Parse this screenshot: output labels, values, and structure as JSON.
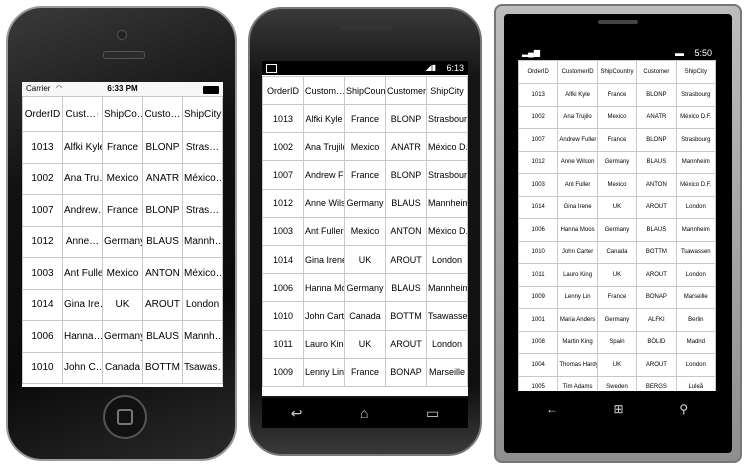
{
  "iphone": {
    "status": {
      "carrier": "Carrier",
      "wifi_icon": "wifi-icon",
      "time": "6:33 PM",
      "battery_icon": "battery-icon"
    },
    "headers": [
      "OrderID",
      "Cust…",
      "ShipCo…",
      "Custo…",
      "ShipCity"
    ],
    "rows": [
      [
        "1013",
        "Alfki Kyle",
        "France",
        "BLONP",
        "Stras…"
      ],
      [
        "1002",
        "Ana Tru…",
        "Mexico",
        "ANATR",
        "México…"
      ],
      [
        "1007",
        "Andrew…",
        "France",
        "BLONP",
        "Stras…"
      ],
      [
        "1012",
        "Anne…",
        "Germany",
        "BLAUS",
        "Mannh…"
      ],
      [
        "1003",
        "Ant Fuller",
        "Mexico",
        "ANTON",
        "México…"
      ],
      [
        "1014",
        "Gina Ire…",
        "UK",
        "AROUT",
        "London"
      ],
      [
        "1006",
        "Hanna…",
        "Germany",
        "BLAUS",
        "Mannh…"
      ],
      [
        "1010",
        "John C…",
        "Canada",
        "BOTTM",
        "Tsawas…"
      ]
    ]
  },
  "android": {
    "status": {
      "time": "6:13"
    },
    "headers": [
      "OrderID",
      "Custom…",
      "ShipCoun…",
      "Customer",
      "ShipCity"
    ],
    "rows": [
      [
        "1013",
        "Alfki Kyle",
        "France",
        "BLONP",
        "Strasbourg"
      ],
      [
        "1002",
        "Ana Trujilo",
        "Mexico",
        "ANATR",
        "México D.F."
      ],
      [
        "1007",
        "Andrew Fu",
        "France",
        "BLONP",
        "Strasbourg"
      ],
      [
        "1012",
        "Anne Wilso",
        "Germany",
        "BLAUS",
        "Mannheim"
      ],
      [
        "1003",
        "Ant Fuller",
        "Mexico",
        "ANTON",
        "México D.F."
      ],
      [
        "1014",
        "Gina Irene",
        "UK",
        "AROUT",
        "London"
      ],
      [
        "1006",
        "Hanna Mo",
        "Germany",
        "BLAUS",
        "Mannheim"
      ],
      [
        "1010",
        "John Carte",
        "Canada",
        "BOTTM",
        "Tsawassen"
      ],
      [
        "1011",
        "Lauro King",
        "UK",
        "AROUT",
        "London"
      ],
      [
        "1009",
        "Lenny Lin",
        "France",
        "BONAP",
        "Marseille"
      ]
    ],
    "nav": {
      "back_icon": "back-icon",
      "home_icon": "home-icon",
      "recents_icon": "recents-icon"
    }
  },
  "winphone": {
    "status": {
      "time": "5:50"
    },
    "headers": [
      "OrderID",
      "CustomerID",
      "ShipCountry",
      "Customer",
      "ShipCity"
    ],
    "rows": [
      [
        "1013",
        "Alfki Kyle",
        "France",
        "BLONP",
        "Strasbourg"
      ],
      [
        "1002",
        "Ana Trujilo",
        "Mexico",
        "ANATR",
        "México D.F."
      ],
      [
        "1007",
        "Andrew Fuller",
        "France",
        "BLONP",
        "Strasbourg"
      ],
      [
        "1012",
        "Anne Wilson",
        "Germany",
        "BLAUS",
        "Mannheim"
      ],
      [
        "1003",
        "Ant Fuller",
        "Mexico",
        "ANTON",
        "México D.F."
      ],
      [
        "1014",
        "Gina Irene",
        "UK",
        "AROUT",
        "London"
      ],
      [
        "1006",
        "Hanna Moos",
        "Germany",
        "BLAUS",
        "Mannheim"
      ],
      [
        "1010",
        "John Carter",
        "Canada",
        "BOTTM",
        "Tsawassen"
      ],
      [
        "1011",
        "Lauro King",
        "UK",
        "AROUT",
        "London"
      ],
      [
        "1009",
        "Lenny Lin",
        "France",
        "BONAP",
        "Marseille"
      ],
      [
        "1001",
        "Maria Anders",
        "Germany",
        "ALFKI",
        "Berlin"
      ],
      [
        "1008",
        "Martin King",
        "Spain",
        "BÓLID",
        "Madrid"
      ],
      [
        "1004",
        "Thomas Hardy",
        "UK",
        "AROUT",
        "London"
      ],
      [
        "1005",
        "Tim Adams",
        "Sweden",
        "BERGS",
        "Luleå"
      ]
    ],
    "nav": {
      "back_icon": "back-arrow-icon",
      "start_icon": "windows-logo-icon",
      "search_icon": "search-icon"
    }
  }
}
